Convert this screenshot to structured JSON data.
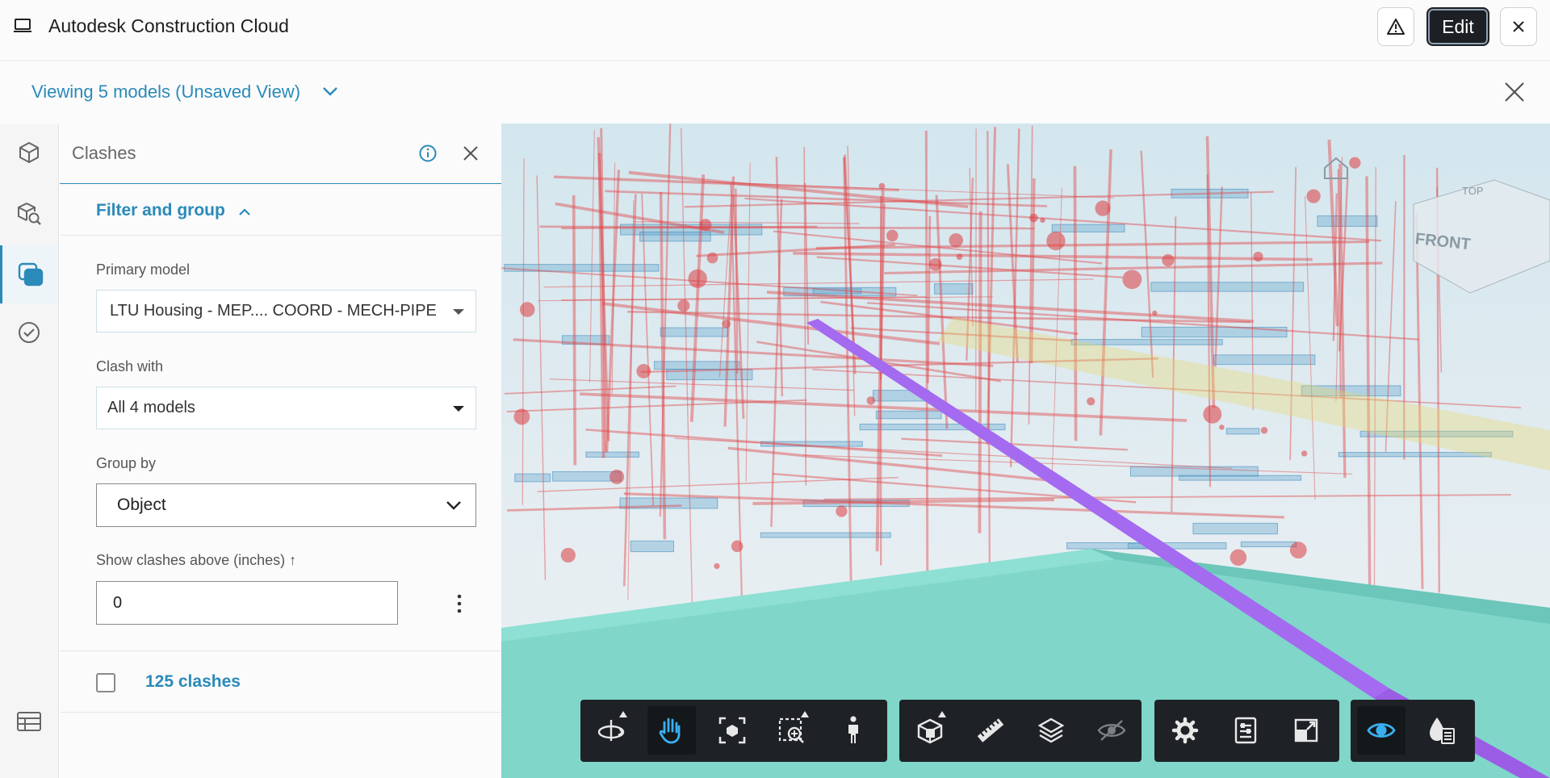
{
  "app": {
    "title": "Autodesk Construction Cloud",
    "edit_label": "Edit"
  },
  "view": {
    "title": "Viewing 5 models (Unsaved View)"
  },
  "panel": {
    "title": "Clashes",
    "section_title": "Filter and group",
    "primary_model_label": "Primary model",
    "primary_model_value": "LTU Housing - MEP.... COORD - MECH-PIPE",
    "clash_with_label": "Clash with",
    "clash_with_value": "All 4 models",
    "group_by_label": "Group by",
    "group_by_value": "Object",
    "threshold_label": "Show clashes above (inches) ↑",
    "threshold_value": "0",
    "clash_count": "125 clashes"
  },
  "viewcube": {
    "label": "FRONT",
    "top_label": "TOP"
  },
  "colors": {
    "accent": "#2a8ab9",
    "toolbar": "#1e2226",
    "clash_purple": "#9b5de5",
    "floor_teal": "#7fd6c9"
  },
  "rail_icons": [
    "model-browser-icon",
    "model-search-icon",
    "clashes-icon",
    "checklist-icon",
    "table-icon"
  ],
  "toolbar_icons": [
    "orbit-icon",
    "pan-icon",
    "fit-view-icon",
    "zoom-window-icon",
    "first-person-icon",
    "section-box-icon",
    "measure-icon",
    "layers-icon",
    "hide-icon",
    "settings-icon",
    "properties-icon",
    "fullscreen-icon",
    "ghosting-icon",
    "color-code-icon"
  ]
}
